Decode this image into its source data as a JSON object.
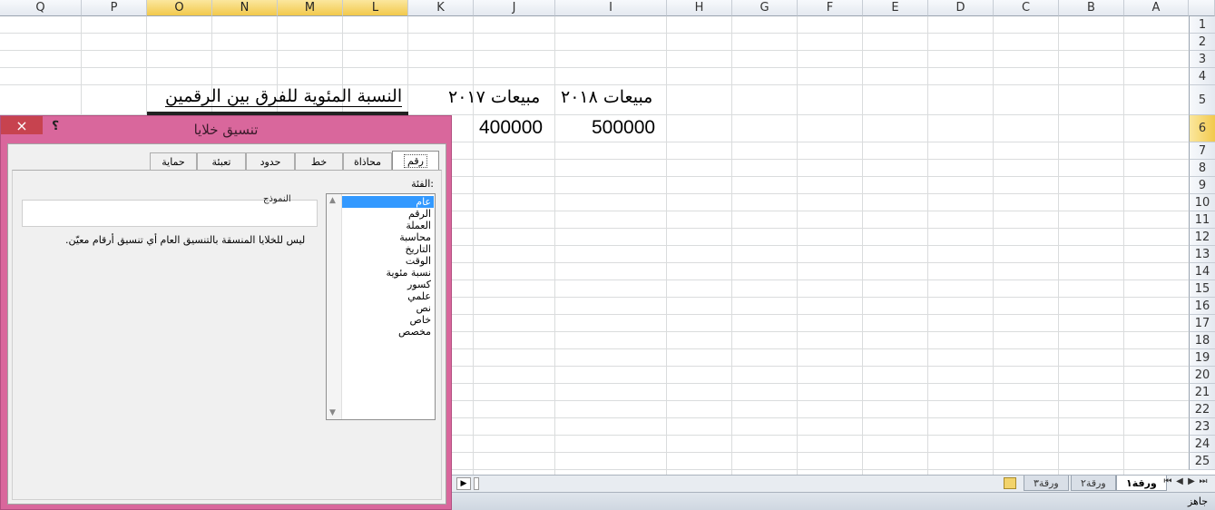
{
  "sheet": {
    "columns": [
      "Q",
      "P",
      "O",
      "N",
      "M",
      "L",
      "K",
      "J",
      "I",
      "H",
      "G",
      "F",
      "E",
      "D",
      "C",
      "B",
      "A"
    ],
    "selected_columns": [
      "O",
      "N",
      "M",
      "L"
    ],
    "rows": [
      "1",
      "2",
      "3",
      "4",
      "5",
      "6",
      "7",
      "8",
      "9",
      "10",
      "11",
      "12",
      "13",
      "14",
      "15",
      "16",
      "17",
      "18",
      "19",
      "20",
      "21",
      "22",
      "23",
      "24",
      "25"
    ],
    "selected_row": "6",
    "cells": {
      "header_2018": "مبيعات ٢٠١٨",
      "header_2017": "مبيعات ٢٠١٧",
      "header_percent": "النسبة المئوية للفرق بين الرقمين",
      "value_2018": "500000",
      "value_2017": "400000"
    }
  },
  "sheet_tabs": {
    "tabs": [
      "ورقة١",
      "ورقة٢",
      "ورقة٣"
    ],
    "active": "ورقة١",
    "new_sheet_icon": "new-sheet-icon"
  },
  "status": {
    "ready": "جاهز"
  },
  "dialog": {
    "title": "تنسيق خلايا",
    "close_label": "×",
    "help_label": "؟",
    "tabs": [
      "رقم",
      "محاذاة",
      "خط",
      "حدود",
      "تعبئة",
      "حماية"
    ],
    "active_tab": "رقم",
    "category_label": "الفئة:",
    "categories": [
      "عام",
      "الرقم",
      "العملة",
      "محاسبة",
      "التاريخ",
      "الوقت",
      "نسبة مئوية",
      "كسور",
      "علمي",
      "نص",
      "خاص",
      "مخصص"
    ],
    "selected_category": "عام",
    "sample_label": "النموذج",
    "description": "ليس للخلايا المنسقة بالتنسيق العام أي تنسيق أرقام معيّن."
  },
  "colors": {
    "dialog_frame": "#d9679c",
    "selected_header": "#f2c94c",
    "selection_blue": "#3399ff",
    "close_button": "#c7434f"
  }
}
